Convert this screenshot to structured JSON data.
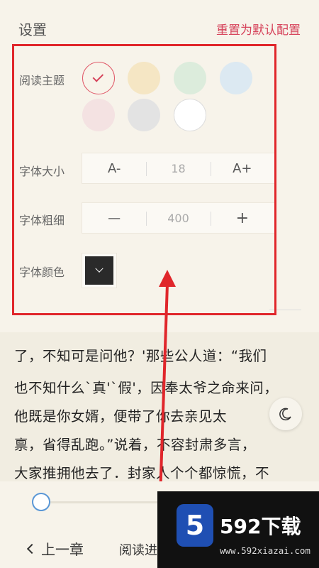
{
  "header": {
    "title": "设置",
    "reset_label": "重置为默认配置"
  },
  "theme": {
    "label": "阅读主题",
    "colors": [
      "#f8f4ea",
      "#f5e6c4",
      "#dcecdc",
      "#dce9f2",
      "#f4e2e2",
      "#e3e3e3",
      "#ffffff"
    ],
    "selected_index": 0
  },
  "font_size": {
    "label": "字体大小",
    "decrease_label": "A-",
    "value": "18",
    "increase_label": "A+"
  },
  "font_weight": {
    "label": "字体粗细",
    "decrease_label": "—",
    "value": "400",
    "increase_label": "+"
  },
  "font_color": {
    "label": "字体颜色",
    "value": "#2a2a2a"
  },
  "reading": {
    "lines": [
      "了，不知可是问他？'那些公人道：“我们",
      "也不知什么`真'`假'，因奉太爷之命来问，",
      "他既是你女婿，便带了你去亲见太",
      "禀，省得乱跑。”说着，不容封肃多言，",
      "大家推拥他去了．封家人个个都惊慌，不"
    ]
  },
  "bottom": {
    "prev_chapter": "上一章",
    "progress_label": "阅读进"
  },
  "watermark": {
    "badge": "5",
    "title": "592下载",
    "url": "www.592xiazai.com"
  },
  "colors": {
    "accent": "#d6425a",
    "annotation": "#e0262b",
    "slider_knob": "#5a97d6"
  }
}
